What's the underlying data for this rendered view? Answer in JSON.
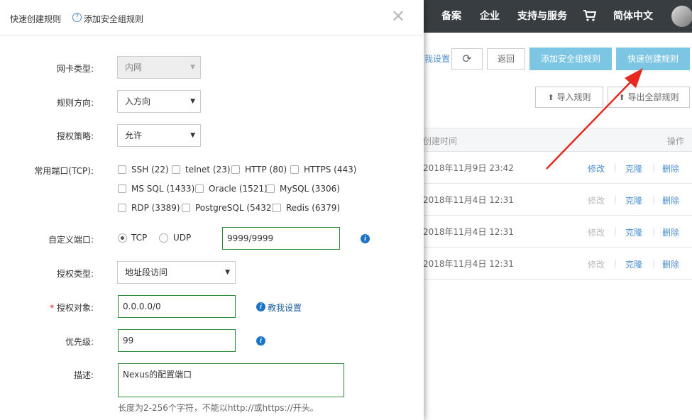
{
  "topnav": {
    "items": [
      "备案",
      "企业",
      "支持与服务",
      "简体中文"
    ],
    "cart_icon": "cart-icon"
  },
  "background": {
    "teach_link": "我设置",
    "back_label": "返回",
    "add_sg_rule_label": "添加安全组规则",
    "quick_create_label": "快速创建规则",
    "import_label": "导入规则",
    "export_label": "导出全部规则",
    "table": {
      "col_created": "创建时间",
      "col_action": "操作",
      "rows": [
        {
          "date": "2018年11月9日 23:42",
          "edit": "修改",
          "clone": "克隆",
          "delete": "删除"
        },
        {
          "date": "2018年11月4日 12:31",
          "edit": "修改",
          "clone": "克隆",
          "delete": "删除"
        },
        {
          "date": "2018年11月4日 12:31",
          "edit": "修改",
          "clone": "克隆",
          "delete": "删除"
        },
        {
          "date": "2018年11月4日 12:31",
          "edit": "修改",
          "clone": "克隆",
          "delete": "删除"
        }
      ]
    }
  },
  "dialog": {
    "title": "快速创建规则",
    "help_icon": "?",
    "help_text": "添加安全组规则",
    "nic_type": {
      "label": "网卡类型:",
      "value": "内网"
    },
    "direction": {
      "label": "规则方向:",
      "value": "入方向"
    },
    "policy": {
      "label": "授权策略:",
      "value": "允许"
    },
    "common_ports": {
      "label": "常用端口(TCP):",
      "options": [
        "SSH (22)",
        "telnet (23)",
        "HTTP (80)",
        "HTTPS (443)",
        "MS SQL (1433)",
        "Oracle (1521)",
        "MySQL (3306)",
        "RDP (3389)",
        "PostgreSQL (5432)",
        "Redis (6379)"
      ]
    },
    "custom_port": {
      "label": "自定义端口:",
      "tcp": "TCP",
      "udp": "UDP",
      "value": "9999/9999"
    },
    "auth_type": {
      "label": "授权类型:",
      "value": "地址段访问"
    },
    "auth_object": {
      "required_mark": "*",
      "label": "授权对象:",
      "value": "0.0.0.0/0",
      "teach_link": "教我设置"
    },
    "priority": {
      "label": "优先级:",
      "value": "99"
    },
    "description": {
      "label": "描述:",
      "value": "Nexus的配置端口",
      "hint": "长度为2-256个字符，不能以http://或https://开头。"
    },
    "info_icon": "i"
  },
  "colors": {
    "topbar": "#373d41",
    "primary_btn": "#7cc6e4",
    "link": "#4d8fcf",
    "arrow": "#e8281f",
    "focus_border": "#2e8b3e"
  }
}
